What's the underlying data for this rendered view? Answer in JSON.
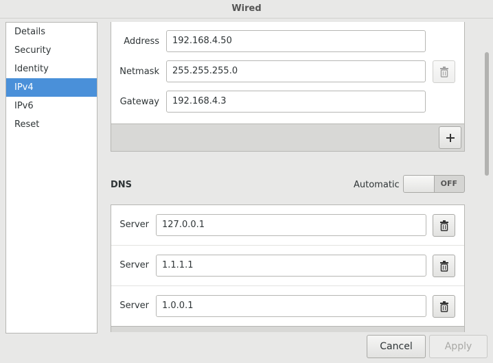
{
  "window": {
    "title": "Wired"
  },
  "sidebar": {
    "items": [
      {
        "label": "Details"
      },
      {
        "label": "Security"
      },
      {
        "label": "Identity"
      },
      {
        "label": "IPv4"
      },
      {
        "label": "IPv6"
      },
      {
        "label": "Reset"
      }
    ],
    "selected": "IPv4"
  },
  "addresses": {
    "address_label": "Address",
    "address_value": "192.168.4.50",
    "netmask_label": "Netmask",
    "netmask_value": "255.255.255.0",
    "gateway_label": "Gateway",
    "gateway_value": "192.168.4.3",
    "add_icon": "plus-icon",
    "delete_icon": "trash-icon"
  },
  "dns": {
    "title": "DNS",
    "automatic_label": "Automatic",
    "automatic_state": "OFF",
    "servers": [
      {
        "label": "Server",
        "value": "127.0.0.1"
      },
      {
        "label": "Server",
        "value": "1.1.1.1"
      },
      {
        "label": "Server",
        "value": "1.0.0.1"
      }
    ]
  },
  "buttons": {
    "cancel": "Cancel",
    "apply": "Apply"
  },
  "colors": {
    "accent": "#4a90d9",
    "window_bg": "#e8e8e7",
    "border": "#b6b6b3"
  }
}
